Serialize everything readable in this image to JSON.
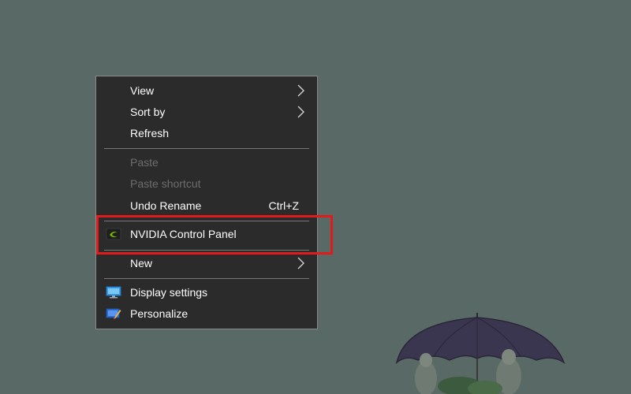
{
  "context_menu": {
    "items": [
      {
        "label": "View",
        "has_submenu": true,
        "disabled": false
      },
      {
        "label": "Sort by",
        "has_submenu": true,
        "disabled": false
      },
      {
        "label": "Refresh",
        "has_submenu": false,
        "disabled": false
      },
      {
        "label": "Paste",
        "has_submenu": false,
        "disabled": true
      },
      {
        "label": "Paste shortcut",
        "has_submenu": false,
        "disabled": true
      },
      {
        "label": "Undo Rename",
        "shortcut": "Ctrl+Z",
        "has_submenu": false,
        "disabled": false
      },
      {
        "label": "NVIDIA Control Panel",
        "icon": "nvidia-icon",
        "has_submenu": false,
        "disabled": false
      },
      {
        "label": "New",
        "has_submenu": true,
        "disabled": false
      },
      {
        "label": "Display settings",
        "icon": "display-settings-icon",
        "has_submenu": false,
        "disabled": false
      },
      {
        "label": "Personalize",
        "icon": "personalize-icon",
        "has_submenu": false,
        "disabled": false
      }
    ]
  },
  "colors": {
    "desktop_background": "#596a66",
    "menu_background": "#2b2b2b",
    "highlight_border": "#e01b1b",
    "disabled_text": "#6d6d6d",
    "nvidia_green": "#76b900"
  }
}
